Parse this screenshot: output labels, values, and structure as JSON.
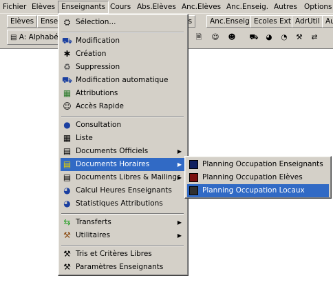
{
  "menubar": {
    "items": [
      "Fichier",
      "Elèves",
      "Enseignants",
      "Cours",
      "Abs.Elèves",
      "Anc.Elèves",
      "Anc.Enseig.",
      "Autres",
      "Options"
    ]
  },
  "tabs": {
    "items": [
      "Elèves",
      "Ense",
      "ves",
      "Anc.Enseig",
      "Ecoles Ext",
      "AdrUtil",
      "Au"
    ]
  },
  "toolbar": {
    "sort_label": "A: Alphabé"
  },
  "menu": {
    "items": [
      {
        "label": "Sélection...",
        "icon": "selection-icon"
      },
      {
        "label": "Modification",
        "icon": "modification-icon"
      },
      {
        "label": "Création",
        "icon": "creation-icon"
      },
      {
        "label": "Suppression",
        "icon": "suppression-icon"
      },
      {
        "label": "Modification automatique",
        "icon": "auto-modification-icon"
      },
      {
        "label": "Attributions",
        "icon": "attributions-icon"
      },
      {
        "label": "Accès Rapide",
        "icon": "quick-access-icon"
      },
      {
        "label": "Consultation",
        "icon": "consultation-icon"
      },
      {
        "label": "Liste",
        "icon": "list-icon"
      },
      {
        "label": "Documents Officiels",
        "icon": "official-documents-icon"
      },
      {
        "label": "Documents Horaires",
        "icon": "schedule-documents-icon"
      },
      {
        "label": "Documents Libres & Mailings",
        "icon": "free-documents-icon"
      },
      {
        "label": "Calcul Heures Enseignants",
        "icon": "hours-calc-icon"
      },
      {
        "label": "Statistiques Attributions",
        "icon": "statistics-icon"
      },
      {
        "label": "Transferts",
        "icon": "transfers-icon"
      },
      {
        "label": "Utilitaires",
        "icon": "utilities-icon"
      },
      {
        "label": "Tris et Critères Libres",
        "icon": "sort-criteria-icon"
      },
      {
        "label": "Paramètres Enseignants",
        "icon": "teacher-settings-icon"
      }
    ]
  },
  "submenu": {
    "items": [
      {
        "label": "Planning Occupation Enseignants",
        "icon": "planning-teachers-icon"
      },
      {
        "label": "Planning Occupation Elèves",
        "icon": "planning-students-icon"
      },
      {
        "label": "Planning Occupation Locaux",
        "icon": "planning-rooms-icon"
      }
    ]
  },
  "colors": {
    "menu_face": "#d4d0c8",
    "highlight": "#316ac5"
  }
}
